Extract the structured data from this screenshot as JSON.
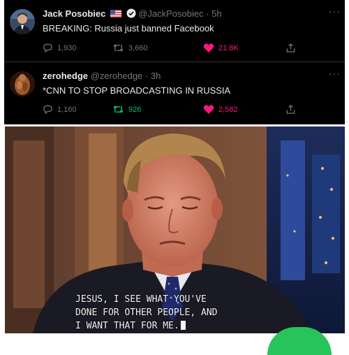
{
  "tweets": [
    {
      "name": "Jack Posobiec",
      "handle": "@JackPosobiec",
      "time": "· 5h",
      "text": "BREAKING: Russia just banned Facebook",
      "reply_count": "1,930",
      "retweet_count": "3,660",
      "like_count": "21.8K",
      "flag_icon": "us-flag-icon",
      "verified_icon": "verified-badge-icon"
    },
    {
      "name": "zerohedge",
      "handle": "@zerohedge",
      "time": "· 3h",
      "text": "*CNN TO STOP BROADCASTING IN RUSSIA",
      "reply_count": "1,160",
      "retweet_count": "926",
      "like_count": "2,582"
    }
  ],
  "more_label": "···",
  "photo": {
    "caption_lines": [
      "JESUS, I SEE WHAT YOU'VE",
      "DONE FOR OTHER PEOPLE, AND",
      "I WANT THAT FOR ME."
    ]
  },
  "colors": {
    "background": "#000000",
    "text": "#e7e9ea",
    "muted": "#71767b",
    "like_pink": "#f91880",
    "retweet_green": "#00ba7c",
    "corner_green": "#27c35b"
  }
}
